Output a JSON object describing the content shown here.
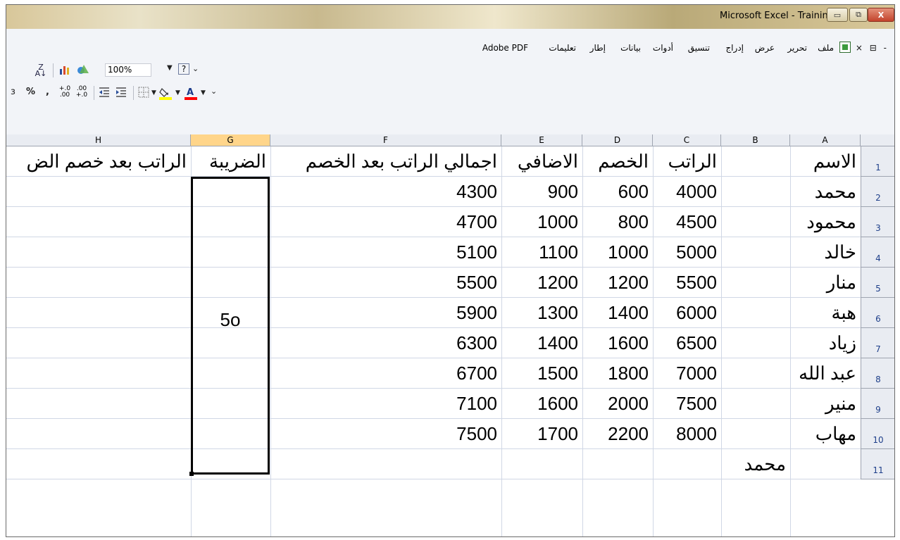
{
  "window": {
    "title": "Microsoft Excel - Training"
  },
  "window_controls": {
    "minimize": "▭",
    "maximize": "⧉",
    "close": "X"
  },
  "doc_controls": "× ⊟ -",
  "menu": [
    "ملف",
    "تحرير",
    "عرض",
    "إدراج",
    "تنسيق",
    "أدوات",
    "بيانات",
    "إطار",
    "تعليمات",
    "Adobe PDF"
  ],
  "toolbar": {
    "zoom": "100%",
    "sort_icon": "sort-az-icon",
    "chart_icon": "chart-wizard-icon",
    "drawing_icon": "drawing-icon",
    "help_icon": "help-icon",
    "percent": "%",
    "comma": ",",
    "fill_color": "#ffff00",
    "font_color": "#ff0000"
  },
  "columns": [
    "H",
    "G",
    "F",
    "E",
    "D",
    "C",
    "B",
    "A"
  ],
  "selected_column": "G",
  "rows": [
    "1",
    "2",
    "3",
    "4",
    "5",
    "6",
    "7",
    "8",
    "9",
    "10",
    "11"
  ],
  "headers": {
    "A": "الاسم",
    "C": "الراتب",
    "D": "الخصم",
    "E": "الاضافي",
    "F": "اجمالي الراتب بعد الخصم",
    "G": "الضريبة",
    "H": "الراتب بعد خصم الض"
  },
  "data": [
    {
      "name": "محمد",
      "salary": "4000",
      "deduction": "600",
      "extra": "900",
      "total": "4300"
    },
    {
      "name": "محمود",
      "salary": "4500",
      "deduction": "800",
      "extra": "1000",
      "total": "4700"
    },
    {
      "name": "خالد",
      "salary": "5000",
      "deduction": "1000",
      "extra": "1100",
      "total": "5100"
    },
    {
      "name": "منار",
      "salary": "5500",
      "deduction": "1200",
      "extra": "1200",
      "total": "5500"
    },
    {
      "name": "هبة",
      "salary": "6000",
      "deduction": "1400",
      "extra": "1300",
      "total": "5900"
    },
    {
      "name": "زياد",
      "salary": "6500",
      "deduction": "1600",
      "extra": "1400",
      "total": "6300"
    },
    {
      "name": "عبد الله",
      "salary": "7000",
      "deduction": "1800",
      "extra": "1500",
      "total": "6700"
    },
    {
      "name": "منير",
      "salary": "7500",
      "deduction": "2000",
      "extra": "1600",
      "total": "7100"
    },
    {
      "name": "مهاب",
      "salary": "8000",
      "deduction": "2200",
      "extra": "1700",
      "total": "7500"
    }
  ],
  "tax_value": "5o",
  "row11_b": "محمد"
}
